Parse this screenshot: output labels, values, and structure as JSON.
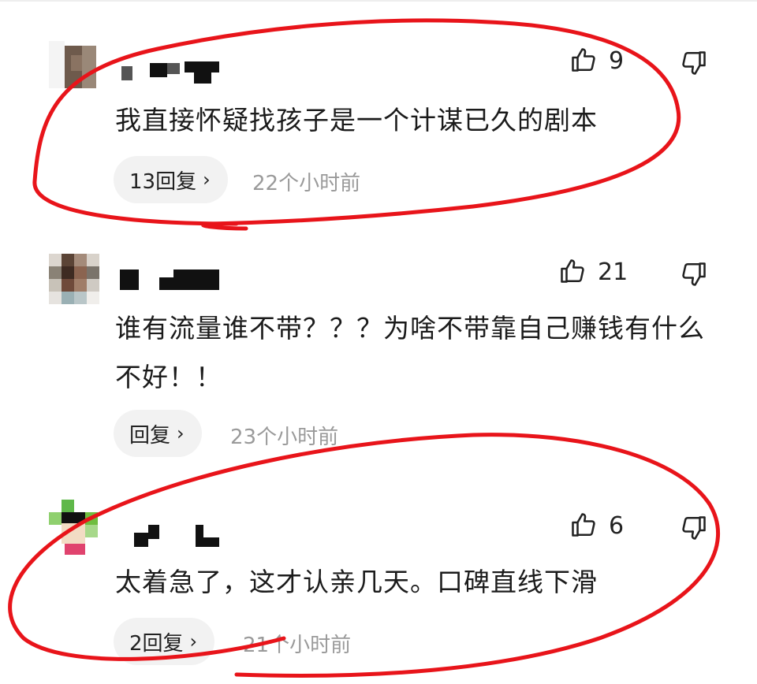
{
  "comments": [
    {
      "likes": "9",
      "text": "我直接怀疑找孩子是一个计谋已久的剧本",
      "reply_label": "13回复",
      "time": "22个小时前"
    },
    {
      "likes": "21",
      "text": "谁有流量谁不带？？？为啥不带靠自己赚钱有什么不好！！",
      "reply_label": "回复",
      "time": "23个小时前"
    },
    {
      "likes": "6",
      "text": "太着急了，这才认亲几天。口碑直线下滑",
      "reply_label": "2回复",
      "time": "21个小时前"
    }
  ],
  "icons": {
    "like": "thumbs-up-icon",
    "dislike": "thumbs-down-icon",
    "chevron": "chevron-right-icon"
  },
  "colors": {
    "annotation_red": "#e8141a",
    "muted_text": "#9a9a9a",
    "reply_bg": "#f2f2f2"
  }
}
